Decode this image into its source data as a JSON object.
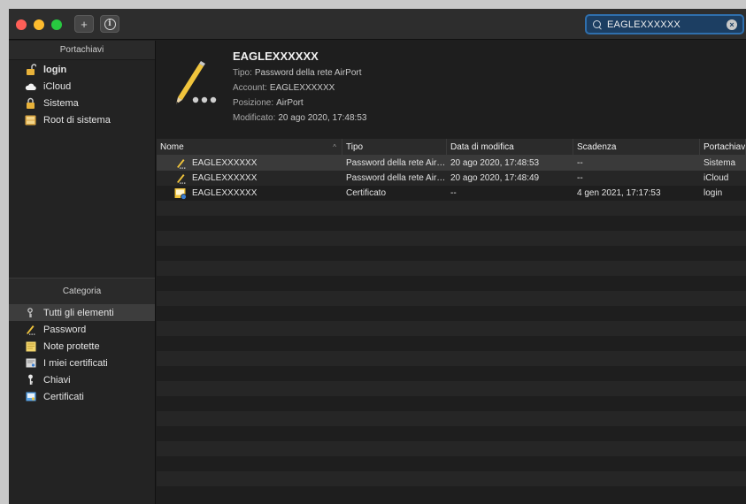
{
  "search": {
    "value": "EAGLEXXXXXX"
  },
  "sidebar": {
    "keychains_header": "Portachiavi",
    "keychains": [
      {
        "label": "login",
        "icon": "lock-open-icon",
        "bold": true
      },
      {
        "label": "iCloud",
        "icon": "cloud-icon",
        "bold": false
      },
      {
        "label": "Sistema",
        "icon": "lock-icon",
        "bold": false
      },
      {
        "label": "Root di sistema",
        "icon": "root-cabinet-icon",
        "bold": false
      }
    ],
    "category_header": "Categoria",
    "categories": [
      {
        "label": "Tutti gli elementi",
        "icon": "all-items-icon",
        "selected": true
      },
      {
        "label": "Password",
        "icon": "pencil-icon",
        "selected": false
      },
      {
        "label": "Note protette",
        "icon": "note-icon",
        "selected": false
      },
      {
        "label": "I miei certificati",
        "icon": "my-certificate-icon",
        "selected": false
      },
      {
        "label": "Chiavi",
        "icon": "key-icon",
        "selected": false
      },
      {
        "label": "Certificati",
        "icon": "certificate-icon",
        "selected": false
      }
    ]
  },
  "detail": {
    "title": "EAGLEXXXXXX",
    "tipo_key": "Tipo:",
    "tipo_val": "Password della rete AirPort",
    "account_key": "Account:",
    "account_val": "EAGLEXXXXXX",
    "posizione_key": "Posizione:",
    "posizione_val": "AirPort",
    "modificato_key": "Modificato:",
    "modificato_val": "20 ago 2020, 17:48:53"
  },
  "table": {
    "columns": [
      "Nome",
      "Tipo",
      "Data di modifica",
      "Scadenza",
      "Portachiavi"
    ],
    "rows": [
      {
        "icon": "password-pencil-icon",
        "name": "EAGLEXXXXXX",
        "tipo": "Password della rete AirPort",
        "data": "20 ago 2020, 17:48:53",
        "scadenza": "--",
        "portachiavi": "Sistema",
        "selected": true
      },
      {
        "icon": "password-pencil-icon",
        "name": "EAGLEXXXXXX",
        "tipo": "Password della rete AirPort",
        "data": "20 ago 2020, 17:48:49",
        "scadenza": "--",
        "portachiavi": "iCloud",
        "selected": false
      },
      {
        "icon": "certificate-icon",
        "name": "EAGLEXXXXXX",
        "tipo": "Certificato",
        "data": "--",
        "scadenza": "4 gen 2021, 17:17:53",
        "portachiavi": "login",
        "selected": false
      }
    ]
  }
}
